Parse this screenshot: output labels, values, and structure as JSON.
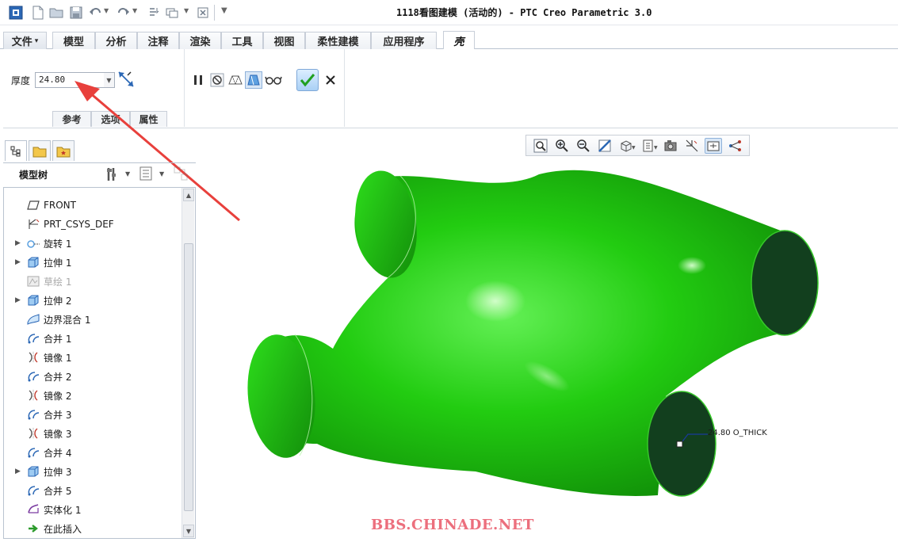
{
  "window": {
    "title": "1118看图建模 (活动的) - PTC Creo Parametric 3.0"
  },
  "quick_access": [
    {
      "icon": "app-logo-icon"
    },
    {
      "icon": "new-file-icon"
    },
    {
      "icon": "open-folder-icon"
    },
    {
      "icon": "save-icon"
    },
    {
      "icon": "undo-icon"
    },
    {
      "icon": "redo-icon"
    },
    {
      "icon": "regenerate-icon"
    },
    {
      "icon": "windows-icon"
    },
    {
      "icon": "close-window-icon"
    },
    {
      "icon": "customize-icon"
    }
  ],
  "tabs": [
    {
      "label": "文件",
      "dropdown": "▾"
    },
    {
      "label": "模型"
    },
    {
      "label": "分析"
    },
    {
      "label": "注释"
    },
    {
      "label": "渲染"
    },
    {
      "label": "工具"
    },
    {
      "label": "视图"
    },
    {
      "label": "柔性建模"
    },
    {
      "label": "应用程序"
    },
    {
      "label": "壳",
      "active": true
    }
  ],
  "shell": {
    "thickness_label": "厚度",
    "thickness_value": "24.80",
    "subtabs": [
      "参考",
      "选项",
      "属性"
    ]
  },
  "panel": {
    "title": "模型树"
  },
  "tree": {
    "items": [
      {
        "label": "FRONT",
        "icon": "datum-plane-icon",
        "expandable": false,
        "dim": false
      },
      {
        "label": "PRT_CSYS_DEF",
        "icon": "csys-icon",
        "expandable": false,
        "dim": false
      },
      {
        "label": "旋转 1",
        "icon": "revolve-icon",
        "expandable": true,
        "dim": false
      },
      {
        "label": "拉伸 1",
        "icon": "extrude-icon",
        "expandable": true,
        "dim": false
      },
      {
        "label": "草绘 1",
        "icon": "sketch-icon",
        "expandable": false,
        "dim": true
      },
      {
        "label": "拉伸 2",
        "icon": "extrude-icon",
        "expandable": true,
        "dim": false
      },
      {
        "label": "边界混合 1",
        "icon": "boundary-blend-icon",
        "expandable": false,
        "dim": false
      },
      {
        "label": "合并 1",
        "icon": "merge-icon",
        "expandable": false,
        "dim": false
      },
      {
        "label": "镜像 1",
        "icon": "mirror-icon",
        "expandable": false,
        "dim": false
      },
      {
        "label": "合并 2",
        "icon": "merge-icon",
        "expandable": false,
        "dim": false
      },
      {
        "label": "镜像 2",
        "icon": "mirror-icon",
        "expandable": false,
        "dim": false
      },
      {
        "label": "合并 3",
        "icon": "merge-icon",
        "expandable": false,
        "dim": false
      },
      {
        "label": "镜像 3",
        "icon": "mirror-icon",
        "expandable": false,
        "dim": false
      },
      {
        "label": "合并 4",
        "icon": "merge-icon",
        "expandable": false,
        "dim": false
      },
      {
        "label": "拉伸 3",
        "icon": "extrude-icon",
        "expandable": true,
        "dim": false
      },
      {
        "label": "合并 5",
        "icon": "merge-icon",
        "expandable": false,
        "dim": false
      },
      {
        "label": "实体化 1",
        "icon": "solidify-icon",
        "expandable": false,
        "dim": false
      },
      {
        "label": "在此插入",
        "icon": "insert-here-icon",
        "expandable": false,
        "dim": false
      }
    ]
  },
  "viewport": {
    "dimension_label": "24.80 O_THICK",
    "model_color": "#22cc11",
    "cap_color": "#123f1e"
  },
  "watermark": "BBS.CHINADE.NET",
  "colors": {
    "arrow": "#e8403c",
    "accent": "#2b67b5"
  }
}
